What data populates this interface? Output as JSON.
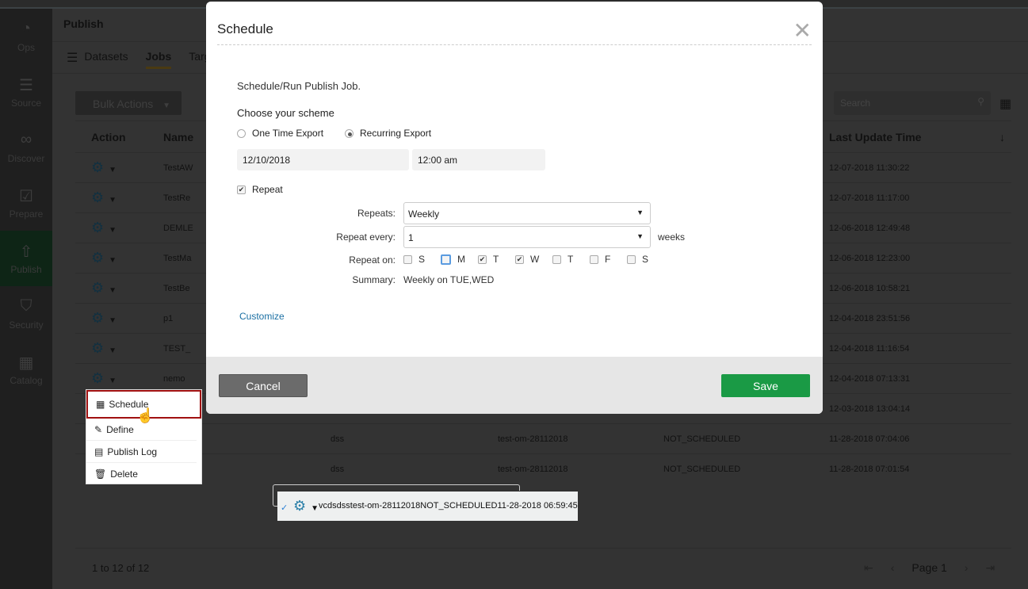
{
  "sidebar": {
    "items": [
      {
        "label": "Ops",
        "icon": "gauge-icon"
      },
      {
        "label": "Source",
        "icon": "database-icon"
      },
      {
        "label": "Discover",
        "icon": "binoculars-icon"
      },
      {
        "label": "Prepare",
        "icon": "clipboard-icon"
      },
      {
        "label": "Publish",
        "icon": "rocket-icon",
        "active": true
      },
      {
        "label": "Security",
        "icon": "shield-icon"
      },
      {
        "label": "Catalog",
        "icon": "grid-icon"
      }
    ]
  },
  "header": {
    "title": "Publish"
  },
  "tabs": [
    {
      "label": "Datasets"
    },
    {
      "label": "Jobs",
      "active": true
    },
    {
      "label": "Targ"
    }
  ],
  "toolbar": {
    "bulk_actions": "Bulk Actions",
    "search_placeholder": "Search"
  },
  "table": {
    "headers": [
      "Action",
      "Name",
      "",
      "",
      "",
      "Last Update Time"
    ],
    "rows": [
      {
        "name": "TestAW",
        "c3": "",
        "c4": "",
        "c5": "",
        "updated": "12-07-2018 11:30:22"
      },
      {
        "name": "TestRe",
        "c3": "",
        "c4": "",
        "c5": "",
        "updated": "12-07-2018 11:17:00"
      },
      {
        "name": "DEMLE",
        "c3": "",
        "c4": "",
        "c5": "",
        "updated": "12-06-2018 12:49:48"
      },
      {
        "name": "TestMa",
        "c3": "",
        "c4": "",
        "c5": "",
        "updated": "12-06-2018 12:23:00"
      },
      {
        "name": "TestBe",
        "c3": "",
        "c4": "",
        "c5": "",
        "updated": "12-06-2018 10:58:21"
      },
      {
        "name": "p1",
        "c3": "",
        "c4": "",
        "c5": "",
        "updated": "12-04-2018 23:51:56"
      },
      {
        "name": "TEST_",
        "c3": "",
        "c4": "",
        "c5": "",
        "updated": "12-04-2018 11:16:54"
      },
      {
        "name": "nemo",
        "c3": "",
        "c4": "",
        "c5": "",
        "updated": "12-04-2018 07:13:31"
      },
      {
        "name": "",
        "c3": "",
        "c4": "",
        "c5": "",
        "updated": "12-03-2018 13:04:14"
      },
      {
        "name": "",
        "c3": "dss",
        "c4": "test-om-28112018",
        "c5": "NOT_SCHEDULED",
        "updated": "11-28-2018 07:04:06"
      },
      {
        "name": "",
        "c3": "dss",
        "c4": "test-om-28112018",
        "c5": "NOT_SCHEDULED",
        "updated": "11-28-2018 07:01:54"
      },
      {
        "name": "vcds",
        "c3": "dss",
        "c4": "test-om-28112018",
        "c5": "NOT_SCHEDULED",
        "updated": "11-28-2018 06:59:45",
        "selected": true
      }
    ]
  },
  "pagination": {
    "count": "1 to 12 of 12",
    "page": "Page 1"
  },
  "context_menu": {
    "items": [
      "Schedule",
      "Define",
      "Publish Log",
      "Delete"
    ]
  },
  "dialog": {
    "title": "Schedule",
    "subtitle": "Schedule/Run Publish Job.",
    "scheme_label": "Choose your scheme",
    "one_time": "One Time Export",
    "recurring": "Recurring Export",
    "selected_scheme": "Recurring Export",
    "date": "12/10/2018",
    "time": "12:00 am",
    "repeat_label": "Repeat",
    "repeat_checked": true,
    "repeats_label": "Repeats:",
    "repeats_value": "Weekly",
    "every_label": "Repeat every:",
    "every_value": "1",
    "every_unit": "weeks",
    "on_label": "Repeat on:",
    "days": [
      {
        "l": "S",
        "c": false
      },
      {
        "l": "M",
        "c": false
      },
      {
        "l": "T",
        "c": true
      },
      {
        "l": "W",
        "c": true
      },
      {
        "l": "T",
        "c": false
      },
      {
        "l": "F",
        "c": false
      },
      {
        "l": "S",
        "c": false
      }
    ],
    "summary_label": "Summary:",
    "summary_value": "Weekly on TUE,WED",
    "customize": "Customize",
    "cancel": "Cancel",
    "save": "Save"
  },
  "colors": {
    "save": "#1a9a45",
    "link": "#1a6fa3",
    "highlight": "#a01010"
  }
}
